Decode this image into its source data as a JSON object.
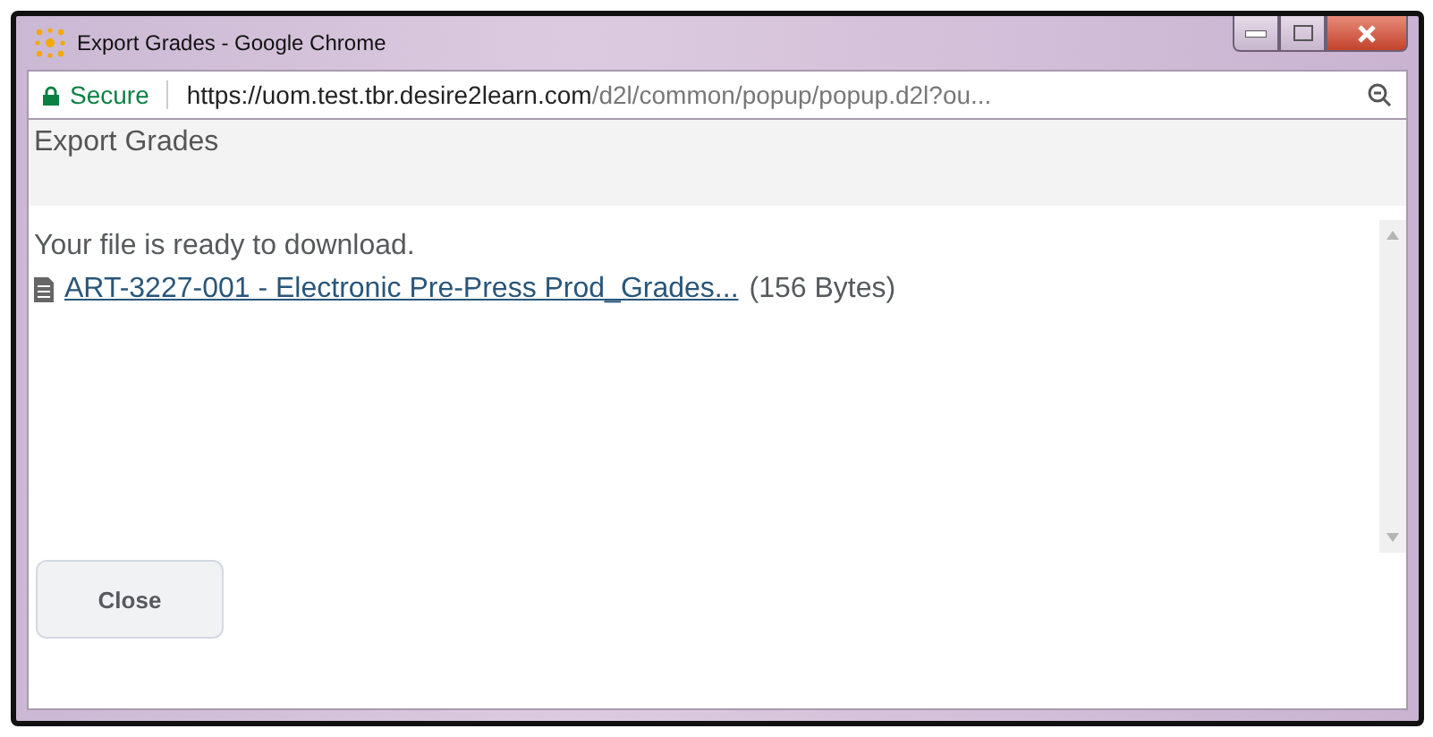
{
  "window": {
    "title": "Export Grades - Google Chrome"
  },
  "address_bar": {
    "security": "Secure",
    "url_host": "https://uom.test.tbr.desire2learn.com",
    "url_path": "/d2l/common/popup/popup.d2l?ou..."
  },
  "page": {
    "heading": "Export Grades",
    "message": "Your file is ready to download.",
    "file_link": "ART-3227-001 - Electronic Pre-Press Prod_Grades...",
    "file_size": "(156 Bytes)"
  },
  "buttons": [
    "Close"
  ]
}
